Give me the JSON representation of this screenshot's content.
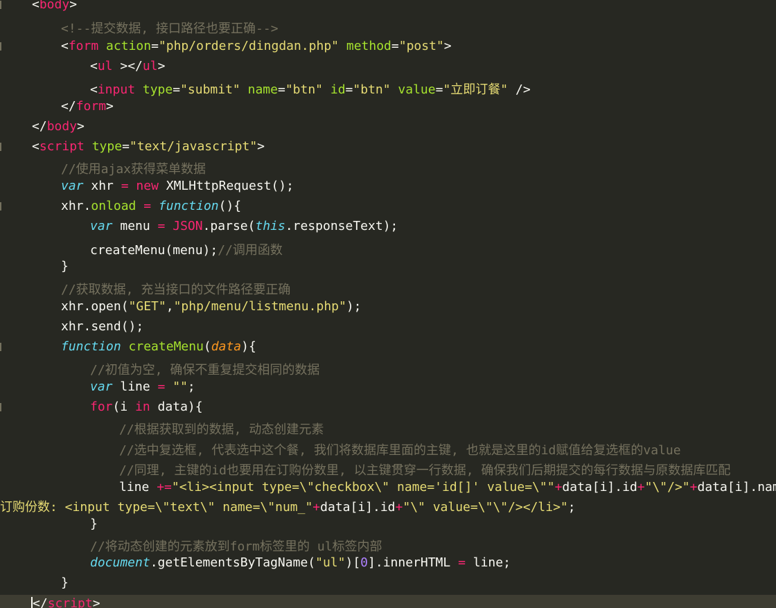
{
  "editor": {
    "theme_colors": {
      "background": "#272822",
      "current_line": "#3e3d32",
      "tag": "#f92672",
      "attribute": "#a6e22e",
      "string": "#e6db74",
      "comment": "#75715e",
      "keyword": "#66d9ef",
      "parameter": "#fd971f",
      "number": "#ae81ff",
      "text": "#f8f8f2"
    },
    "lines": [
      {
        "indent": 1,
        "gutter": true,
        "segments": [
          {
            "t": "<",
            "c": "txt"
          },
          {
            "t": "body",
            "c": "tag"
          },
          {
            "t": ">",
            "c": "txt"
          }
        ]
      },
      {
        "indent": 2,
        "gutter": false,
        "segments": [
          {
            "t": "<!--提交数据, 接口路径也要正确-->",
            "c": "cmt"
          }
        ]
      },
      {
        "indent": 2,
        "gutter": true,
        "segments": [
          {
            "t": "<",
            "c": "txt"
          },
          {
            "t": "form",
            "c": "tag"
          },
          {
            "t": " ",
            "c": "txt"
          },
          {
            "t": "action",
            "c": "attr"
          },
          {
            "t": "=",
            "c": "txt"
          },
          {
            "t": "\"php/orders/dingdan.php\"",
            "c": "str"
          },
          {
            "t": " ",
            "c": "txt"
          },
          {
            "t": "method",
            "c": "attr"
          },
          {
            "t": "=",
            "c": "txt"
          },
          {
            "t": "\"post\"",
            "c": "str"
          },
          {
            "t": ">",
            "c": "txt"
          }
        ]
      },
      {
        "indent": 3,
        "gutter": false,
        "segments": [
          {
            "t": "<",
            "c": "txt"
          },
          {
            "t": "ul",
            "c": "tag"
          },
          {
            "t": " ></",
            "c": "txt"
          },
          {
            "t": "ul",
            "c": "tag"
          },
          {
            "t": ">",
            "c": "txt"
          }
        ]
      },
      {
        "indent": 3,
        "gutter": false,
        "segments": [
          {
            "t": "<",
            "c": "txt"
          },
          {
            "t": "input",
            "c": "tag"
          },
          {
            "t": " ",
            "c": "txt"
          },
          {
            "t": "type",
            "c": "attr"
          },
          {
            "t": "=",
            "c": "txt"
          },
          {
            "t": "\"submit\"",
            "c": "str"
          },
          {
            "t": " ",
            "c": "txt"
          },
          {
            "t": "name",
            "c": "attr"
          },
          {
            "t": "=",
            "c": "txt"
          },
          {
            "t": "\"btn\"",
            "c": "str"
          },
          {
            "t": " ",
            "c": "txt"
          },
          {
            "t": "id",
            "c": "attr"
          },
          {
            "t": "=",
            "c": "txt"
          },
          {
            "t": "\"btn\"",
            "c": "str"
          },
          {
            "t": " ",
            "c": "txt"
          },
          {
            "t": "value",
            "c": "attr"
          },
          {
            "t": "=",
            "c": "txt"
          },
          {
            "t": "\"立即订餐\"",
            "c": "str"
          },
          {
            "t": " />",
            "c": "txt"
          }
        ]
      },
      {
        "indent": 2,
        "gutter": false,
        "segments": [
          {
            "t": "</",
            "c": "txt"
          },
          {
            "t": "form",
            "c": "tag"
          },
          {
            "t": ">",
            "c": "txt"
          }
        ]
      },
      {
        "indent": 1,
        "gutter": false,
        "segments": [
          {
            "t": "</",
            "c": "txt"
          },
          {
            "t": "body",
            "c": "tag"
          },
          {
            "t": ">",
            "c": "txt"
          }
        ]
      },
      {
        "indent": 1,
        "gutter": true,
        "segments": [
          {
            "t": "<",
            "c": "txt"
          },
          {
            "t": "script",
            "c": "tag"
          },
          {
            "t": " ",
            "c": "txt"
          },
          {
            "t": "type",
            "c": "attr"
          },
          {
            "t": "=",
            "c": "txt"
          },
          {
            "t": "\"text/javascript\"",
            "c": "str"
          },
          {
            "t": ">",
            "c": "txt"
          }
        ]
      },
      {
        "indent": 2,
        "gutter": false,
        "segments": [
          {
            "t": "//使用ajax获得菜单数据",
            "c": "cmt"
          }
        ]
      },
      {
        "indent": 2,
        "gutter": false,
        "segments": [
          {
            "t": "var",
            "c": "kw"
          },
          {
            "t": " xhr ",
            "c": "txt"
          },
          {
            "t": "=",
            "c": "op"
          },
          {
            "t": " ",
            "c": "txt"
          },
          {
            "t": "new",
            "c": "kwr"
          },
          {
            "t": " XMLHttpRequest();",
            "c": "txt"
          }
        ]
      },
      {
        "indent": 2,
        "gutter": true,
        "segments": [
          {
            "t": "xhr.",
            "c": "txt"
          },
          {
            "t": "onload",
            "c": "fn"
          },
          {
            "t": " ",
            "c": "txt"
          },
          {
            "t": "=",
            "c": "op"
          },
          {
            "t": " ",
            "c": "txt"
          },
          {
            "t": "function",
            "c": "kw"
          },
          {
            "t": "(){",
            "c": "txt"
          }
        ]
      },
      {
        "indent": 3,
        "gutter": false,
        "segments": [
          {
            "t": "var",
            "c": "kw"
          },
          {
            "t": " menu ",
            "c": "txt"
          },
          {
            "t": "=",
            "c": "op"
          },
          {
            "t": " ",
            "c": "txt"
          },
          {
            "t": "JSON",
            "c": "tag"
          },
          {
            "t": ".parse(",
            "c": "txt"
          },
          {
            "t": "this",
            "c": "kw"
          },
          {
            "t": ".responseText);",
            "c": "txt"
          }
        ]
      },
      {
        "indent": 3,
        "gutter": false,
        "segments": [
          {
            "t": "createMenu(menu);",
            "c": "txt"
          },
          {
            "t": "//调用函数",
            "c": "cmt"
          }
        ]
      },
      {
        "indent": 2,
        "gutter": false,
        "segments": [
          {
            "t": "}",
            "c": "txt"
          }
        ]
      },
      {
        "indent": 2,
        "gutter": false,
        "segments": [
          {
            "t": "//获取数据, 充当接口的文件路径要正确",
            "c": "cmt"
          }
        ]
      },
      {
        "indent": 2,
        "gutter": false,
        "segments": [
          {
            "t": "xhr.open(",
            "c": "txt"
          },
          {
            "t": "\"GET\"",
            "c": "str"
          },
          {
            "t": ",",
            "c": "txt"
          },
          {
            "t": "\"php/menu/listmenu.php\"",
            "c": "str"
          },
          {
            "t": ");",
            "c": "txt"
          }
        ]
      },
      {
        "indent": 2,
        "gutter": false,
        "segments": [
          {
            "t": "xhr.send();",
            "c": "txt"
          }
        ]
      },
      {
        "indent": 2,
        "gutter": true,
        "segments": [
          {
            "t": "function",
            "c": "kw"
          },
          {
            "t": " ",
            "c": "txt"
          },
          {
            "t": "createMenu",
            "c": "fn"
          },
          {
            "t": "(",
            "c": "txt"
          },
          {
            "t": "data",
            "c": "param"
          },
          {
            "t": "){",
            "c": "txt"
          }
        ]
      },
      {
        "indent": 3,
        "gutter": false,
        "segments": [
          {
            "t": "//初值为空, 确保不重复提交相同的数据",
            "c": "cmt"
          }
        ]
      },
      {
        "indent": 3,
        "gutter": false,
        "segments": [
          {
            "t": "var",
            "c": "kw"
          },
          {
            "t": " line ",
            "c": "txt"
          },
          {
            "t": "=",
            "c": "op"
          },
          {
            "t": " ",
            "c": "txt"
          },
          {
            "t": "\"\"",
            "c": "str"
          },
          {
            "t": ";",
            "c": "txt"
          }
        ]
      },
      {
        "indent": 3,
        "gutter": true,
        "segments": [
          {
            "t": "for",
            "c": "kwr"
          },
          {
            "t": "(i ",
            "c": "txt"
          },
          {
            "t": "in",
            "c": "kwr"
          },
          {
            "t": " data){",
            "c": "txt"
          }
        ]
      },
      {
        "indent": 4,
        "gutter": false,
        "segments": [
          {
            "t": "//根据获取到的数据, 动态创建元素",
            "c": "cmt"
          }
        ]
      },
      {
        "indent": 4,
        "gutter": false,
        "segments": [
          {
            "t": "//选中复选框, 代表选中这个餐, 我们将数据库里面的主键, 也就是这里的id赋值给复选框的value",
            "c": "cmt"
          }
        ]
      },
      {
        "indent": 4,
        "gutter": false,
        "segments": [
          {
            "t": "//同理, 主键的id也要用在订购份数里, 以主键贯穿一行数据, 确保我们后期提交的每行数据与原数据库匹配",
            "c": "cmt"
          }
        ]
      },
      {
        "indent": 4,
        "gutter": false,
        "segments": [
          {
            "t": "line ",
            "c": "txt"
          },
          {
            "t": "+=",
            "c": "op"
          },
          {
            "t": "\"<li><input type=\\\"checkbox\\\" name='id[]' value=\\\"\"",
            "c": "str"
          },
          {
            "t": "+",
            "c": "op"
          },
          {
            "t": "data[i].id",
            "c": "txt"
          },
          {
            "t": "+",
            "c": "op"
          },
          {
            "t": "\"\\\"/>\"",
            "c": "str"
          },
          {
            "t": "+",
            "c": "op"
          },
          {
            "t": "data[i].name",
            "c": "txt"
          },
          {
            "t": "+",
            "c": "op"
          },
          {
            "t": "\"",
            "c": "str"
          }
        ]
      },
      {
        "indent": 0,
        "gutter": false,
        "segments": [
          {
            "t": "订购份数: <input type=\\\"text\\\" name=\\\"num_\"",
            "c": "str"
          },
          {
            "t": "+",
            "c": "op"
          },
          {
            "t": "data[i].id",
            "c": "txt"
          },
          {
            "t": "+",
            "c": "op"
          },
          {
            "t": "\"\\\" value=\\\"\\\"/></li>\"",
            "c": "str"
          },
          {
            "t": ";",
            "c": "txt"
          }
        ]
      },
      {
        "indent": 3,
        "gutter": false,
        "segments": [
          {
            "t": "}",
            "c": "txt"
          }
        ]
      },
      {
        "indent": 3,
        "gutter": false,
        "segments": [
          {
            "t": "//将动态创建的元素放到form标签里的 ul标签内部",
            "c": "cmt"
          }
        ]
      },
      {
        "indent": 3,
        "gutter": false,
        "segments": [
          {
            "t": "document",
            "c": "kw"
          },
          {
            "t": ".getElementsByTagName(",
            "c": "txt"
          },
          {
            "t": "\"ul\"",
            "c": "str"
          },
          {
            "t": ")[",
            "c": "txt"
          },
          {
            "t": "0",
            "c": "num"
          },
          {
            "t": "].innerHTML ",
            "c": "txt"
          },
          {
            "t": "=",
            "c": "op"
          },
          {
            "t": " line;",
            "c": "txt"
          }
        ]
      },
      {
        "indent": 2,
        "gutter": false,
        "segments": [
          {
            "t": "}",
            "c": "txt"
          }
        ]
      },
      {
        "indent": 1,
        "gutter": false,
        "current": true,
        "cursor": true,
        "segments": [
          {
            "t": "</",
            "c": "txt"
          },
          {
            "t": "script",
            "c": "tag"
          },
          {
            "t": ">",
            "c": "txt"
          }
        ]
      }
    ]
  }
}
